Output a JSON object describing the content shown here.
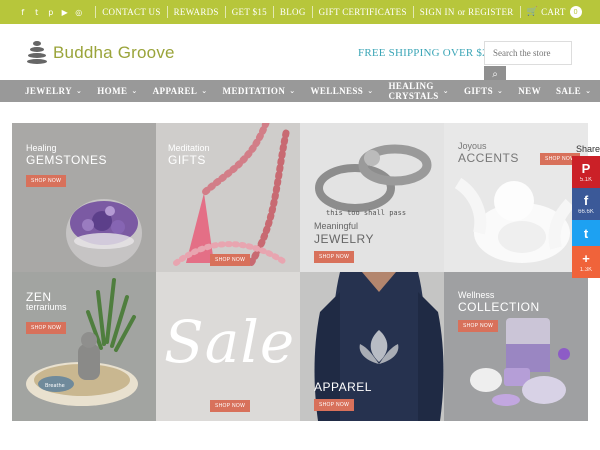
{
  "topbar": {
    "icons": [
      "facebook-icon",
      "twitter-icon",
      "pinterest-icon",
      "youtube-icon",
      "instagram-icon"
    ],
    "links": [
      "CONTACT US",
      "REWARDS",
      "GET $15",
      "BLOG",
      "GIFT CERTIFICATES"
    ],
    "signin": "SIGN IN",
    "or": "or",
    "register": "REGISTER",
    "cart_label": "CART",
    "cart_count": "0",
    "bg_color": "#b7c63b"
  },
  "header": {
    "logo_text": "Buddha Groove",
    "free_shipping": "FREE SHIPPING OVER $25*",
    "search_placeholder": "Search the store"
  },
  "nav": {
    "items": [
      {
        "label": "JEWELRY",
        "dropdown": true
      },
      {
        "label": "HOME",
        "dropdown": true
      },
      {
        "label": "APPAREL",
        "dropdown": true
      },
      {
        "label": "MEDITATION",
        "dropdown": true
      },
      {
        "label": "WELLNESS",
        "dropdown": true
      },
      {
        "label": "HEALING CRYSTALS",
        "dropdown": true
      },
      {
        "label": "GIFTS",
        "dropdown": true
      },
      {
        "label": "NEW",
        "dropdown": false
      },
      {
        "label": "SALE",
        "dropdown": true
      }
    ]
  },
  "tiles": [
    {
      "line1": "Healing",
      "line2": "GEMSTONES",
      "cta": "SHOP NOW"
    },
    {
      "line1": "Meditation",
      "line2": "GIFTS",
      "cta": "SHOP NOW"
    },
    {
      "line1": "Meaningful",
      "line2": "JEWELRY",
      "cta": "SHOP NOW",
      "ring_text": "this too shall pass"
    },
    {
      "line1": "Joyous",
      "line2": "ACCENTS",
      "cta": "SHOP NOW"
    },
    {
      "line1": "ZEN",
      "line2": "terrariums",
      "cta": "SHOP NOW",
      "stone_text": "Breathe"
    },
    {
      "line1": "",
      "line2": "Sale",
      "cta": "SHOP NOW"
    },
    {
      "line1": "",
      "line2": "APPAREL",
      "cta": "SHOP NOW"
    },
    {
      "line1": "Wellness",
      "line2": "COLLECTION",
      "cta": "SHOP NOW"
    }
  ],
  "share": {
    "label": "Share",
    "buttons": [
      {
        "icon": "pinterest-icon",
        "glyph": "P",
        "count": "5.1K",
        "color": "#cb2027"
      },
      {
        "icon": "facebook-icon",
        "glyph": "f",
        "count": "66.6K",
        "color": "#3b5998"
      },
      {
        "icon": "twitter-icon",
        "glyph": "t",
        "count": "",
        "color": "#1da1f2"
      },
      {
        "icon": "plus-icon",
        "glyph": "+",
        "count": "1.3K",
        "color": "#f0633a"
      }
    ]
  }
}
